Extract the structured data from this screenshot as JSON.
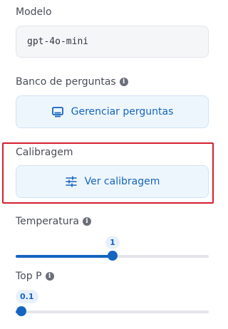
{
  "model": {
    "label": "Modelo",
    "value": "gpt-4o-mini"
  },
  "question_bank": {
    "label": "Banco de perguntas",
    "info_icon": "info-icon",
    "button_label": "Gerenciar perguntas",
    "button_icon": "monitor-icon"
  },
  "calibration": {
    "label": "Calibragem",
    "button_label": "Ver calibragem",
    "button_icon": "sliders-icon",
    "highlight_color": "#d3202f"
  },
  "temperature": {
    "label": "Temperatura",
    "info_icon": "info-icon",
    "value": "1",
    "fraction": 0.5
  },
  "top_p": {
    "label": "Top P",
    "info_icon": "info-icon",
    "value": "0.1",
    "fraction": 0.03
  },
  "colors": {
    "accent": "#1565c0",
    "button_bg": "#eef6fd"
  }
}
